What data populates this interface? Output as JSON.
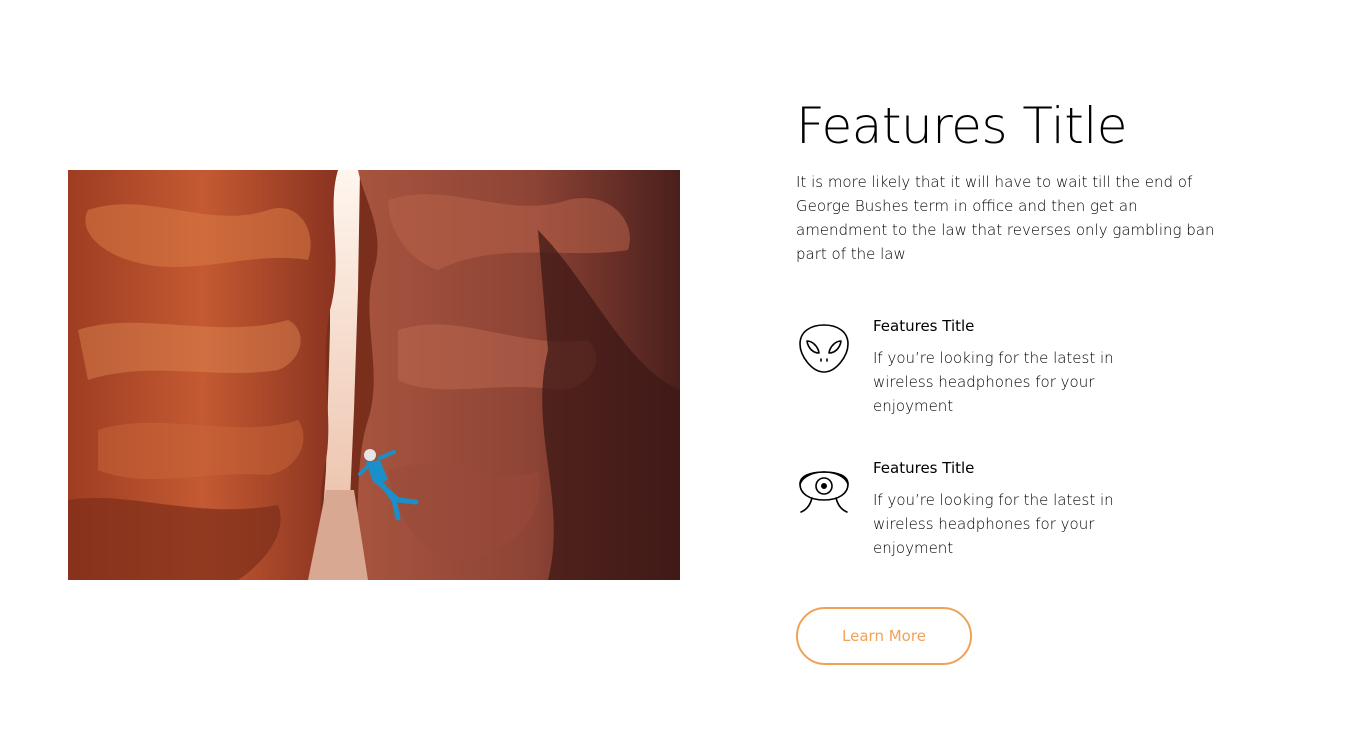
{
  "hero": {
    "image": "canyon-climber-photo"
  },
  "main": {
    "title": "Features Title",
    "description": "It is more likely that it will have to wait till the end of George Bushes term in office and then get an amendment to the law that reverses only gambling ban part of the law"
  },
  "features": [
    {
      "icon": "alien-icon",
      "title": "Features Title",
      "description": "If you’re looking for the latest in wireless headphones for your enjoyment"
    },
    {
      "icon": "eye-robot-icon",
      "title": "Features Title",
      "description": "If you’re looking for the latest in wireless headphones for your enjoyment"
    }
  ],
  "cta": {
    "label": "Learn More"
  },
  "colors": {
    "accent": "#f0a259",
    "text": "#000000",
    "background": "#ffffff"
  }
}
